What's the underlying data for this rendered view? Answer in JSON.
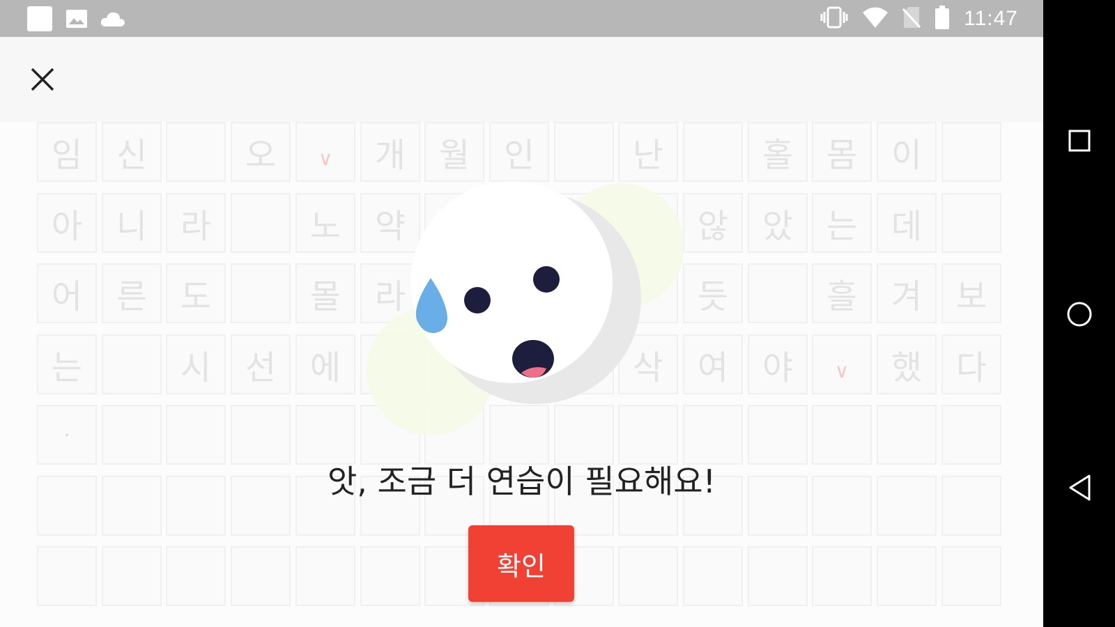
{
  "status_bar": {
    "time": "11:47",
    "left_icons": [
      "square-notification-icon",
      "image-icon",
      "cloud-icon"
    ],
    "right_icons": [
      "vibrate-icon",
      "wifi-icon",
      "no-sim-icon",
      "battery-icon"
    ]
  },
  "header": {
    "close_icon": "close-icon"
  },
  "grid": {
    "rows": [
      [
        "임",
        "신",
        "",
        "오",
        "∨",
        "개",
        "월",
        "인",
        "",
        "난",
        "",
        "홀",
        "몸",
        "이",
        ""
      ],
      [
        "아",
        "니",
        "라",
        "",
        "노",
        "약",
        "",
        "",
        "",
        "",
        "않",
        "았",
        "는",
        "데",
        ""
      ],
      [
        "어",
        "른",
        "도",
        "",
        "몰",
        "라",
        "",
        "",
        "",
        "",
        "듯",
        "",
        "흘",
        "겨",
        "보"
      ],
      [
        "는",
        "",
        "시",
        "선",
        "에",
        "",
        "",
        "",
        "",
        "삭",
        "여",
        "야",
        "∨",
        "했",
        "다"
      ],
      [
        "·",
        "",
        "",
        "",
        "",
        "",
        "",
        "",
        "",
        "",
        "",
        "",
        "",
        "",
        ""
      ],
      [
        "",
        "",
        "",
        "",
        "",
        "",
        "",
        "",
        "",
        "",
        "",
        "",
        "",
        "",
        ""
      ],
      [
        "",
        "",
        "",
        "",
        "",
        "",
        "",
        "",
        "",
        "",
        "",
        "",
        "",
        "",
        ""
      ]
    ]
  },
  "dialog": {
    "message": "앗, 조금 더 연습이 필요해요!",
    "confirm_label": "확인",
    "accent_color": "#f04134"
  },
  "nav_bar": {
    "icons": [
      "recents-square-icon",
      "home-circle-icon",
      "back-triangle-icon"
    ]
  }
}
